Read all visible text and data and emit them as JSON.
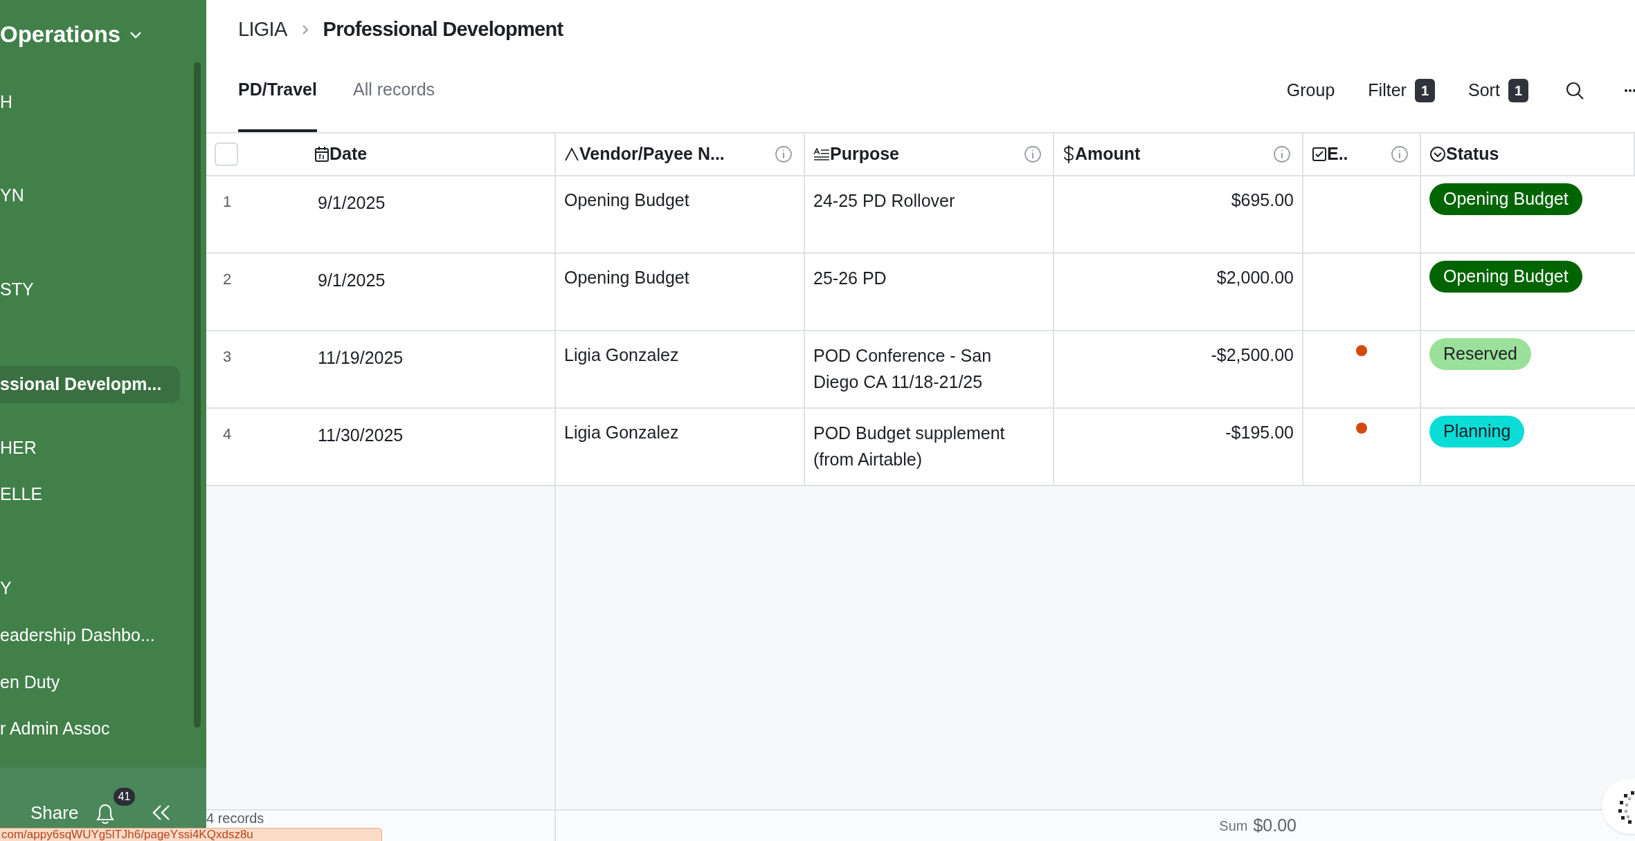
{
  "sidebar": {
    "title": "Operations",
    "items": [
      {
        "label": "H",
        "selected": false
      },
      {
        "label": "YN",
        "selected": false
      },
      {
        "label": "STY",
        "selected": false
      },
      {
        "label": "ssional Developm...",
        "selected": true
      },
      {
        "label": "HER",
        "selected": false
      },
      {
        "label": "ELLE",
        "selected": false
      },
      {
        "label": "Y",
        "selected": false
      },
      {
        "label": "eadership Dashbo...",
        "selected": false
      },
      {
        "label": "en Duty",
        "selected": false
      },
      {
        "label": "r Admin Assoc",
        "selected": false
      }
    ],
    "share": "Share",
    "notifications": "41"
  },
  "breadcrumb": {
    "parent": "LIGIA",
    "current": "Professional Development"
  },
  "tabs": [
    {
      "label": "PD/Travel",
      "selected": true
    },
    {
      "label": "All records",
      "selected": false
    }
  ],
  "toolbar": [
    {
      "label": "Group"
    },
    {
      "label": "Filter",
      "count": "1"
    },
    {
      "label": "Sort",
      "count": "1"
    }
  ],
  "table": {
    "all_selected": false,
    "columns": [
      {
        "label": "Date",
        "kind": "date",
        "info": false
      },
      {
        "label": "Vendor/Payee N...",
        "kind": "text",
        "info": true
      },
      {
        "label": "Purpose",
        "kind": "longtext",
        "info": true
      },
      {
        "label": "Amount",
        "kind": "currency",
        "info": true
      },
      {
        "label": "E..",
        "kind": "checkbox",
        "info": true
      },
      {
        "label": "Status",
        "kind": "select",
        "info": false
      }
    ],
    "rows": [
      {
        "number": "1",
        "date": "9/1/2025",
        "vendor": "Opening Budget",
        "purpose": "24-25 PD Rollover",
        "amount": "$695.00",
        "flagged": false,
        "status": {
          "label": "Opening Budget",
          "color": "#006400"
        }
      },
      {
        "number": "2",
        "date": "9/1/2025",
        "vendor": "Opening Budget",
        "purpose": "25-26 PD",
        "amount": "$2,000.00",
        "flagged": false,
        "status": {
          "label": "Opening Budget",
          "color": "#006400"
        }
      },
      {
        "number": "3",
        "date": "11/19/2025",
        "vendor": "Ligia Gonzalez",
        "purpose": "POD Conference - San Diego CA 11/18-21/25",
        "amount": "-$2,500.00",
        "flagged": true,
        "status": {
          "label": "Reserved",
          "color": "#9be09a"
        }
      },
      {
        "number": "4",
        "date": "11/30/2025",
        "vendor": "Ligia Gonzalez",
        "purpose": "POD Budget supplement (from Airtable)",
        "amount": "-$195.00",
        "flagged": true,
        "status": {
          "label": "Planning",
          "color": "#0adcd6"
        }
      }
    ]
  },
  "footer": {
    "records": "4 records",
    "sum_label": "Sum",
    "sum": "$0.00"
  },
  "link_tooltip": "com/appy6sqWUYg5lTJh6/pageYssi4KQxdsz8u"
}
